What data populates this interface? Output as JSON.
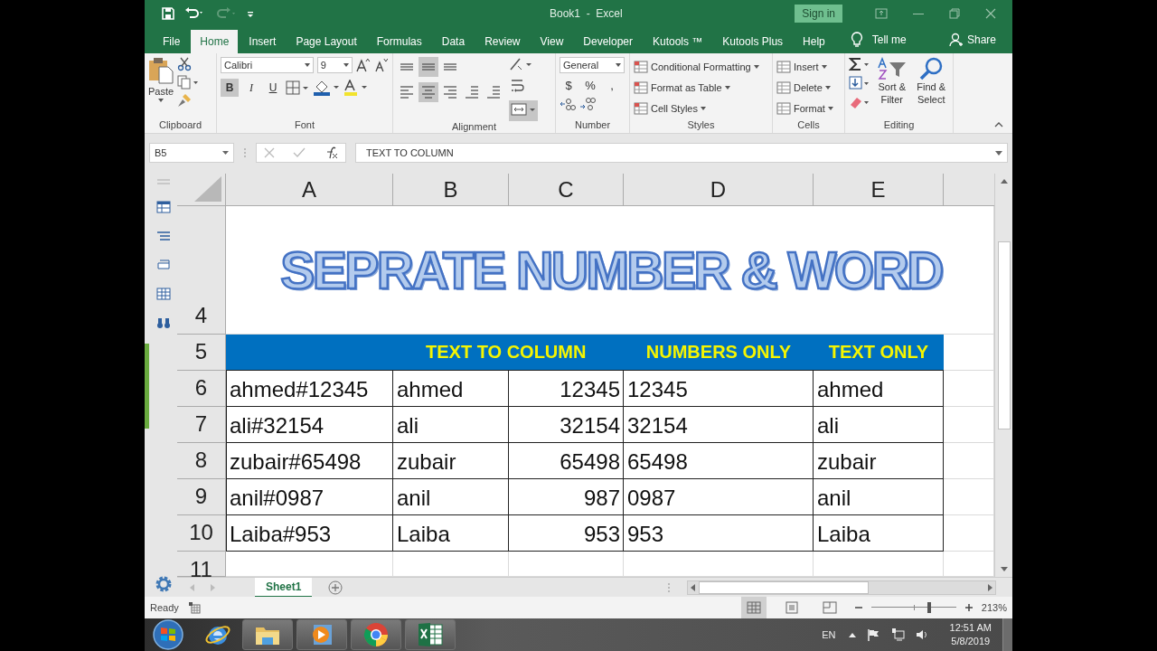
{
  "window": {
    "title": "Book1  -  Excel",
    "sign_in": "Sign in"
  },
  "tabs": [
    {
      "label": "File",
      "selected": false
    },
    {
      "label": "Home",
      "selected": true
    },
    {
      "label": "Insert",
      "selected": false
    },
    {
      "label": "Page Layout",
      "selected": false
    },
    {
      "label": "Formulas",
      "selected": false
    },
    {
      "label": "Data",
      "selected": false
    },
    {
      "label": "Review",
      "selected": false
    },
    {
      "label": "View",
      "selected": false
    },
    {
      "label": "Developer",
      "selected": false
    },
    {
      "label": "Kutools ™",
      "selected": false
    },
    {
      "label": "Kutools Plus",
      "selected": false
    },
    {
      "label": "Help",
      "selected": false
    }
  ],
  "tell_me": "Tell me",
  "share": "Share",
  "ribbon": {
    "clipboard": {
      "paste": "Paste",
      "label": "Clipboard"
    },
    "font": {
      "name": "Calibri",
      "size": "9",
      "label": "Font",
      "buttons": [
        {
          "label": "B",
          "kind": "bold",
          "pressed": true
        },
        {
          "label": "I",
          "kind": "italic",
          "pressed": false
        },
        {
          "label": "U",
          "kind": "underline",
          "pressed": false
        }
      ]
    },
    "alignment": {
      "label": "Alignment",
      "buttons": [
        {
          "kind": "top",
          "pressed": false
        },
        {
          "kind": "middle",
          "pressed": true
        },
        {
          "kind": "bottom",
          "pressed": false
        },
        {
          "kind": "left",
          "pressed": false
        },
        {
          "kind": "center",
          "pressed": true
        },
        {
          "kind": "right",
          "pressed": false
        },
        {
          "kind": "outdent",
          "pressed": false
        },
        {
          "kind": "indent",
          "pressed": false
        }
      ],
      "merge_pressed": true
    },
    "number": {
      "format": "General",
      "label": "Number",
      "symbols": [
        "$",
        "%",
        ","
      ]
    },
    "styles": {
      "label": "Styles",
      "buttons": [
        "Conditional Formatting",
        "Format as Table",
        "Cell Styles"
      ]
    },
    "cells": {
      "label": "Cells",
      "buttons": [
        "Insert",
        "Delete",
        "Format"
      ]
    },
    "editing": {
      "label": "Editing",
      "buttons": [
        "Sort & Filter",
        "Find & Select"
      ]
    }
  },
  "name_box": "B5",
  "formula": "TEXT TO COLUMN",
  "columns": [
    "A",
    "B",
    "C",
    "D",
    "E"
  ],
  "title_row": {
    "row": "4",
    "text": "SEPRATE NUMBER & WORD"
  },
  "header_row": {
    "row": "5",
    "column_bc": "TEXT TO COLUMN",
    "column_d": "NUMBERS ONLY",
    "column_e": "TEXT ONLY"
  },
  "rows": [
    {
      "row": "6",
      "cells": [
        "ahmed#12345",
        "ahmed",
        "12345",
        "12345",
        "ahmed"
      ]
    },
    {
      "row": "7",
      "cells": [
        "ali#32154",
        "ali",
        "32154",
        "32154",
        "ali"
      ]
    },
    {
      "row": "8",
      "cells": [
        "zubair#65498",
        "zubair",
        "65498",
        "65498",
        "zubair"
      ]
    },
    {
      "row": "9",
      "cells": [
        "anil#0987",
        "anil",
        "987",
        "0987",
        "anil"
      ]
    },
    {
      "row": "10",
      "cells": [
        "Laiba#953",
        "Laiba",
        "953",
        "953",
        "Laiba"
      ]
    }
  ],
  "partial_row": "11",
  "sheets": [
    {
      "label": "Sheet1",
      "selected": true
    }
  ],
  "status": "Ready",
  "views": [
    {
      "kind": "normal",
      "selected": true
    },
    {
      "kind": "page-layout",
      "selected": false
    },
    {
      "kind": "page-break",
      "selected": false
    }
  ],
  "zoom": {
    "level": 0.68,
    "reading": "213%"
  },
  "taskbar": {
    "language": "EN",
    "time": "12:51 AM",
    "date": "5/8/2019"
  }
}
